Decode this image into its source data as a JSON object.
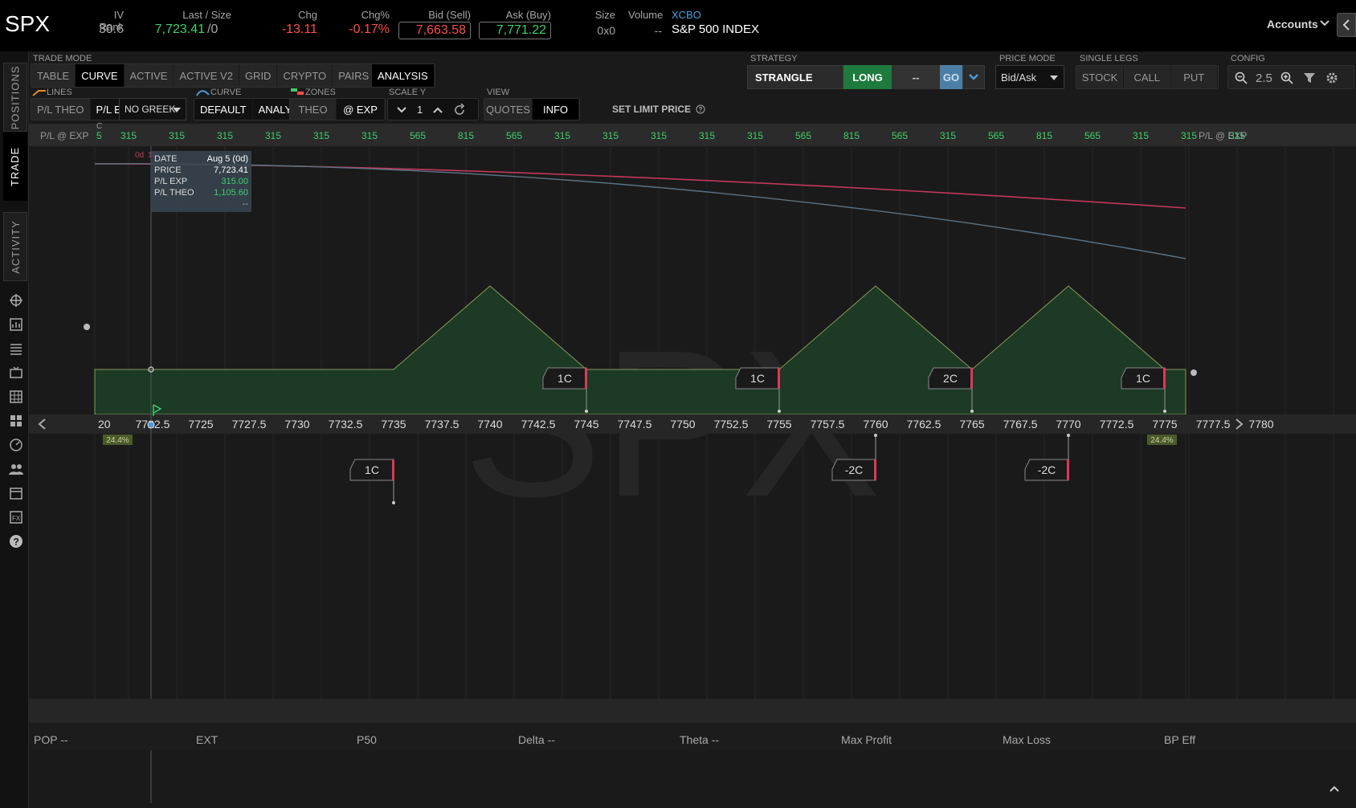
{
  "quote": {
    "symbol": "SPX",
    "iv_rank_label": "IV Rank",
    "iv_rank": "30.6",
    "last_label": "Last / Size",
    "last": "7,723.41",
    "last_size": "/0",
    "chg_label": "Chg",
    "chg": "-13.11",
    "chgpct_label": "Chg%",
    "chgpct": "-0.17%",
    "bid_label": "Bid (Sell)",
    "bid": "7,663.58",
    "ask_label": "Ask (Buy)",
    "ask": "7,771.22",
    "size_label": "Size",
    "size": "0x0",
    "volume_label": "Volume",
    "volume": "--",
    "exchange": "XCBO",
    "description": "S&P 500 INDEX",
    "accounts_label": "Accounts"
  },
  "left_tabs": [
    "POSITIONS",
    "TRADE",
    "ACTIVITY"
  ],
  "left_icons": [
    "crosshair-icon",
    "chart-icon",
    "list-icon",
    "tv-icon",
    "grid-icon",
    "tiles-icon",
    "gauge-icon",
    "people-icon",
    "calendar-icon",
    "fx-icon",
    "help-icon"
  ],
  "trade_mode": {
    "label": "TRADE MODE",
    "tabs": [
      "TABLE",
      "CURVE",
      "ACTIVE",
      "ACTIVE V2",
      "GRID",
      "CRYPTO",
      "PAIRS"
    ],
    "selected": "CURVE",
    "analysis": "ANALYSIS"
  },
  "strategy": {
    "label": "STRATEGY",
    "name": "STRANGLE",
    "side": "LONG",
    "qty": "--",
    "go": "GO"
  },
  "price_mode": {
    "label": "PRICE MODE",
    "value": "Bid/Ask"
  },
  "single_legs": {
    "label": "SINGLE LEGS",
    "items": [
      "STOCK",
      "CALL",
      "PUT"
    ]
  },
  "config": {
    "label": "CONFIG",
    "zoom": "2.5"
  },
  "lines": {
    "label": "LINES",
    "items": [
      "P/L THEO",
      "P/L EXP"
    ],
    "greek": "NO GREEK"
  },
  "curve": {
    "label": "CURVE",
    "items": [
      "DEFAULT",
      "ANALYSIS"
    ]
  },
  "zones": {
    "label": "ZONES",
    "items": [
      "THEO",
      "@ EXP"
    ]
  },
  "scale_y": {
    "label": "SCALE Y",
    "value": "1"
  },
  "view": {
    "label": "VIEW",
    "items": [
      "QUOTES",
      "INFO"
    ]
  },
  "set_limit": "SET LIMIT PRICE",
  "colors": {
    "green": "#3fcf6b",
    "red": "#ff4d4d",
    "pl_fill": "#1c3a24",
    "theo_line": "#c0395a",
    "curve2": "#5a7386"
  },
  "chart": {
    "pl_label_left": "P/L @ EXP",
    "pl_label_right": "P/L @ EXP",
    "pl_first_partial": "5",
    "pl_values": [
      "315",
      "315",
      "315",
      "315",
      "315",
      "315",
      "565",
      "815",
      "565",
      "315",
      "315",
      "315",
      "315",
      "315",
      "565",
      "815",
      "565",
      "315",
      "565",
      "815",
      "565",
      "315",
      "315",
      "315"
    ],
    "price_ticks": [
      "7722.5",
      "7725",
      "7727.5",
      "7730",
      "7732.5",
      "7735",
      "7737.5",
      "7740",
      "7742.5",
      "7745",
      "7747.5",
      "7750",
      "7752.5",
      "7755",
      "7757.5",
      "7760",
      "7762.5",
      "7765",
      "7767.5",
      "7770",
      "7772.5",
      "7775",
      "7777.5",
      "7780"
    ],
    "first_tick_partial": "20",
    "watermark": "SPX",
    "iv_left": "24.4%",
    "iv_right": "24.4%",
    "dte_marker": "0d",
    "dte_marker_partial": "1C",
    "corner_marker": "C",
    "tooltip": {
      "date_label": "DATE",
      "date": "Aug 5 (0d)",
      "price_label": "PRICE",
      "price": "7,723.41",
      "plexp_label": "P/L EXP",
      "plexp": "315.00",
      "pltheo_label": "P/L THEO",
      "pltheo": "1,105.60",
      "extra": "--"
    },
    "legs_upper": [
      {
        "label": "1C",
        "strike": 7745
      },
      {
        "label": "1C",
        "strike": 7755
      },
      {
        "label": "2C",
        "strike": 7765
      },
      {
        "label": "1C",
        "strike": 7775
      }
    ],
    "legs_lower": [
      {
        "label": "1C",
        "strike": 7735
      },
      {
        "label": "-2C",
        "strike": 7760
      },
      {
        "label": "-2C",
        "strike": 7770
      }
    ]
  },
  "stats": [
    "POP --",
    "EXT",
    "P50",
    "Delta --",
    "Theta --",
    "Max Profit",
    "Max Loss",
    "BP Eff"
  ]
}
